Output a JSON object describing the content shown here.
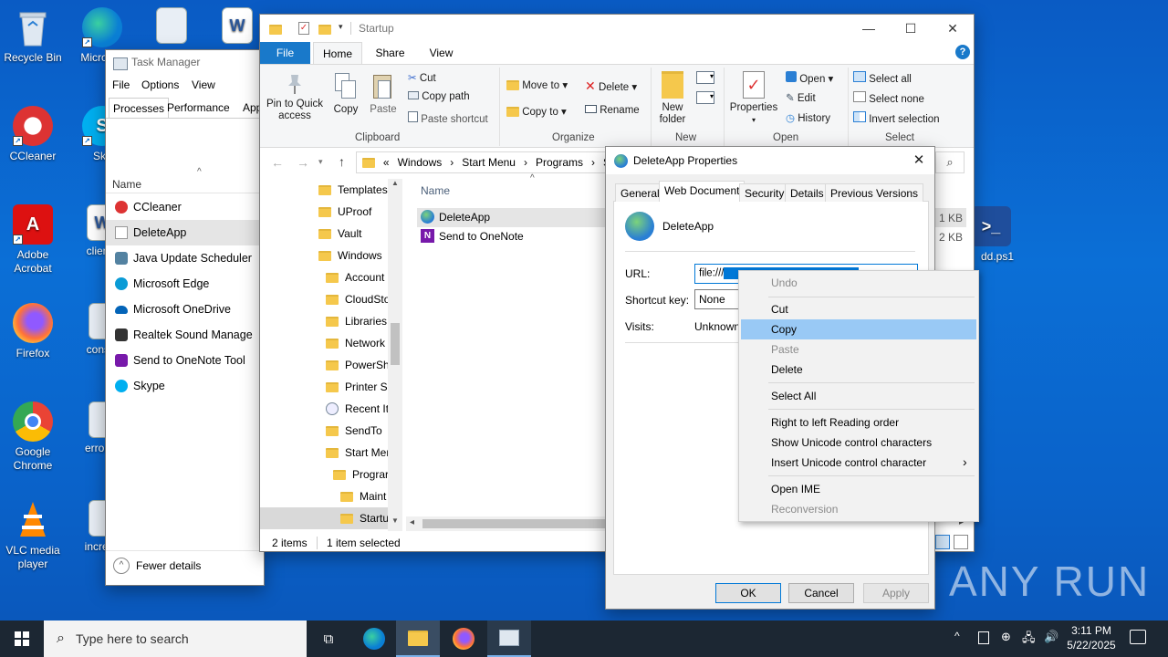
{
  "desktop": {
    "icons": [
      {
        "label": "Recycle Bin"
      },
      {
        "label": "Micro Ed"
      },
      {
        "label": "CCleaner"
      },
      {
        "label": "Sky"
      },
      {
        "label": "Adobe Acrobat"
      },
      {
        "label": "clientb"
      },
      {
        "label": "Firefox"
      },
      {
        "label": "consid"
      },
      {
        "label": "Google Chrome"
      },
      {
        "label": "errorfie"
      },
      {
        "label": "VLC media player"
      },
      {
        "label": "increas"
      },
      {
        "label": "dd.ps1"
      }
    ],
    "watermark": "ANY RUN"
  },
  "task_manager": {
    "title": "Task Manager",
    "menu": [
      "File",
      "Options",
      "View"
    ],
    "tabs": [
      "Processes",
      "Performance",
      "App"
    ],
    "column_name": "Name",
    "rows": [
      "CCleaner",
      "DeleteApp",
      "Java Update Scheduler",
      "Microsoft Edge",
      "Microsoft OneDrive",
      "Realtek Sound Manage",
      "Send to OneNote Tool",
      "Skype"
    ],
    "fewer_details": "Fewer details"
  },
  "explorer": {
    "title": "Startup",
    "ribbon_tabs": [
      "File",
      "Home",
      "Share",
      "View"
    ],
    "clipboard": {
      "pin": "Pin to Quick access",
      "copy": "Copy",
      "paste": "Paste",
      "cut": "Cut",
      "copy_path": "Copy path",
      "paste_shortcut": "Paste shortcut",
      "label": "Clipboard"
    },
    "organize": {
      "move_to": "Move to",
      "copy_to": "Copy to",
      "delete": "Delete",
      "rename": "Rename",
      "label": "Organize"
    },
    "new": {
      "new_folder": "New folder",
      "label": "New"
    },
    "open": {
      "properties": "Properties",
      "open": "Open",
      "edit": "Edit",
      "history": "History",
      "label": "Open"
    },
    "select": {
      "select_all": "Select all",
      "select_none": "Select none",
      "invert": "Invert selection",
      "label": "Select"
    },
    "breadcrumb": [
      "«",
      "Windows",
      "Start Menu",
      "Programs",
      "S"
    ],
    "tree": [
      "Templates",
      "UProof",
      "Vault",
      "Windows",
      "Account",
      "CloudSto",
      "Libraries",
      "Network",
      "PowerSh",
      "Printer Sl",
      "Recent It",
      "SendTo",
      "Start Mer",
      "Prograr",
      "Maint",
      "Startu"
    ],
    "column_name": "Name",
    "files": [
      "DeleteApp",
      "Send to OneNote"
    ],
    "sizes": [
      "1 KB",
      "2 KB"
    ],
    "status": {
      "items": "2 items",
      "selected": "1 item selected"
    }
  },
  "dialog": {
    "title": "DeleteApp Properties",
    "tabs": [
      "General",
      "Web Document",
      "Security",
      "Details",
      "Previous Versions"
    ],
    "name": "DeleteApp",
    "url_label": "URL:",
    "url_value": "file:///",
    "shortcut_label": "Shortcut key:",
    "shortcut_value": "None",
    "visits_label": "Visits:",
    "visits_value": "Unknown",
    "ok": "OK",
    "cancel": "Cancel",
    "apply": "Apply"
  },
  "context_menu": {
    "items": [
      "Undo",
      "Cut",
      "Copy",
      "Paste",
      "Delete",
      "Select All",
      "Right to left Reading order",
      "Show Unicode control characters",
      "Insert Unicode control character",
      "Open IME",
      "Reconversion"
    ],
    "submenu_arrow": "›"
  },
  "taskbar": {
    "search_placeholder": "Type here to search",
    "time": "3:11 PM",
    "date": "5/22/2025"
  },
  "colors": {
    "accent": "#0078d7",
    "menu_highlight": "#99c9f5",
    "selection": "#cce8ff",
    "taskbar": "#1c2733"
  }
}
